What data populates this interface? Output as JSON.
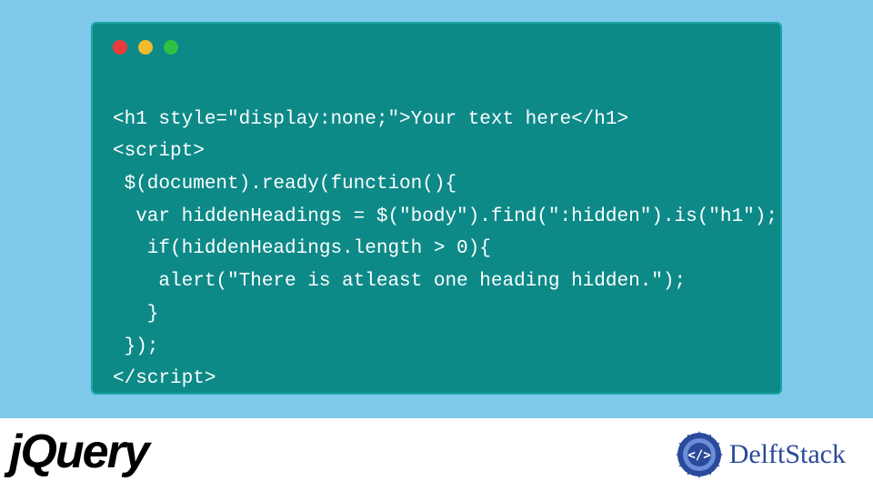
{
  "code": {
    "lines": [
      "<h1 style=\"display:none;\">Your text here</h1>",
      "<script>",
      " $(document).ready(function(){",
      "  var hiddenHeadings = $(\"body\").find(\":hidden\").is(\"h1\");",
      "   if(hiddenHeadings.length > 0){",
      "    alert(\"There is atleast one heading hidden.\");",
      "   }",
      " });",
      "</script>"
    ]
  },
  "footer": {
    "left_logo": "jQuery",
    "right_logo": "DelftStack"
  },
  "colors": {
    "page_bg": "#7fc9ed",
    "panel_bg": "#0d8a88",
    "panel_border": "#1ea5a3",
    "code_text": "#ffffff",
    "dot_red": "#ed3b3b",
    "dot_yellow": "#f1bb2d",
    "dot_green": "#2fc043",
    "delft_blue": "#2b4a9b"
  }
}
